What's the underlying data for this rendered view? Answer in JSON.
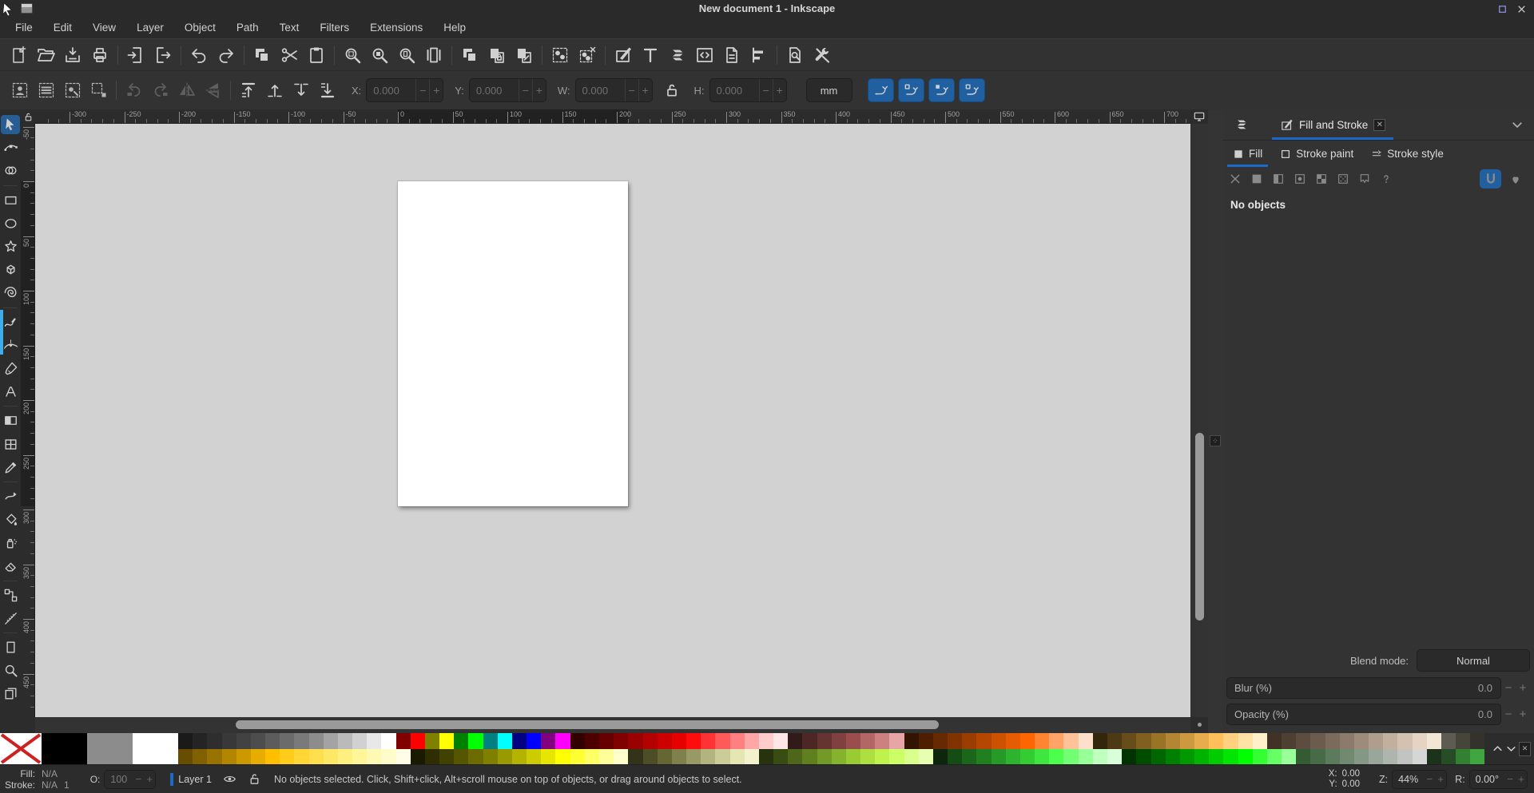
{
  "window": {
    "title": "New document 1 - Inkscape"
  },
  "menu": {
    "items": [
      "File",
      "Edit",
      "View",
      "Layer",
      "Object",
      "Path",
      "Text",
      "Filters",
      "Extensions",
      "Help"
    ]
  },
  "command_toolbar": {
    "groups": [
      [
        "new-document",
        "open-document",
        "save-document",
        "print"
      ],
      [
        "import",
        "export"
      ],
      [
        "undo",
        "redo"
      ],
      [
        "copy",
        "cut",
        "paste"
      ],
      [
        "zoom-selection",
        "zoom-drawing",
        "zoom-page",
        "zoom-1-1"
      ],
      [
        "duplicate",
        "create-clone",
        "unlink-clone"
      ],
      [
        "group",
        "ungroup"
      ],
      [
        "fill-stroke-dialog",
        "text-dialog",
        "layers-dialog",
        "xml-editor",
        "document-properties",
        "align-distribute"
      ],
      [
        "document-find",
        "preferences"
      ]
    ]
  },
  "tool_options": {
    "select_buttons": [
      "select-all",
      "select-all-layers",
      "select-same",
      "deselect"
    ],
    "transform_buttons": [
      "rotate-ccw",
      "rotate-cw",
      "flip-horizontal",
      "flip-vertical"
    ],
    "order_buttons": [
      "raise-to-top",
      "raise",
      "lower",
      "lower-to-bottom"
    ],
    "fields": [
      {
        "label": "X:",
        "value": "0.000"
      },
      {
        "label": "Y:",
        "value": "0.000"
      },
      {
        "label": "W:",
        "value": "0.000"
      },
      {
        "label": "H:",
        "value": "0.000"
      }
    ],
    "minus": "−",
    "plus": "+",
    "unit": "mm",
    "toggles": [
      "scale-stroke",
      "scale-corners",
      "move-gradients",
      "move-patterns"
    ]
  },
  "toolbox": {
    "tools": [
      "selector",
      "node-editor",
      "shape-builder",
      "rectangle",
      "ellipse",
      "star",
      "box-3d",
      "spiral",
      "pencil",
      "pen",
      "calligraphy",
      "text",
      "gradient",
      "mesh",
      "dropper",
      "tweak",
      "paint-bucket",
      "spray",
      "eraser",
      "connector",
      "measure",
      "page",
      "zoom",
      "pages"
    ],
    "active_tool": "selector",
    "separators_after": [
      2,
      7,
      11,
      14,
      18,
      20
    ]
  },
  "rulers": {
    "h_labels": [
      -300,
      -250,
      -200,
      -150,
      -100,
      -50,
      0,
      50,
      100,
      150,
      200,
      250,
      300,
      350,
      400,
      450,
      500,
      550,
      600,
      650,
      700
    ],
    "v_labels": [
      -50,
      0,
      50,
      100,
      150,
      200,
      250,
      300,
      350,
      400,
      450
    ]
  },
  "right_panel": {
    "dock_tab_label": "Fill and Stroke",
    "tabs": [
      {
        "label": "Fill",
        "icon": "fill-tab",
        "active": true
      },
      {
        "label": "Stroke paint",
        "icon": "stroke-paint-tab",
        "active": false
      },
      {
        "label": "Stroke style",
        "icon": "stroke-style-tab",
        "active": false
      }
    ],
    "paint_buttons": [
      "paint-none",
      "paint-flat",
      "paint-linear",
      "paint-radial",
      "paint-pattern",
      "paint-mesh",
      "paint-swatch",
      "paint-unknown"
    ],
    "fill_rule_buttons": [
      {
        "icon": "fillrule-nonzero",
        "active": true
      },
      {
        "icon": "fillrule-evenodd",
        "active": false
      }
    ],
    "no_objects": "No objects",
    "blend_label": "Blend mode:",
    "blend_value": "Normal",
    "blur_label": "Blur (%)",
    "blur_value": "0.0",
    "opacity_label": "Opacity (%)",
    "opacity_value": "0.0"
  },
  "status_bar": {
    "fill_label": "Fill:",
    "fill_value": "N/A",
    "stroke_label": "Stroke:",
    "stroke_value": "N/A",
    "stroke_width": "1",
    "opacity_label": "O:",
    "opacity_value": "100",
    "layer_label": "Layer 1",
    "message": "No objects selected. Click, Shift+click, Alt+scroll mouse on top of objects, or drag around objects to select.",
    "x_label": "X:",
    "x_value": "0.00",
    "y_label": "Y:",
    "y_value": "0.00",
    "zoom_label": "Z:",
    "zoom_value": "44%",
    "rotation_label": "R:",
    "rotation_value": "0.00°"
  },
  "colors": {
    "accent_blue": "#1b6acb",
    "toggle_blue": "#2160a0",
    "active_tool_blue": "#275d93",
    "highlight_stripe": "#3daee9",
    "canvas_desk": "#d2d2d2",
    "page": "#ffffff"
  },
  "palette": {
    "special": [
      {
        "name": "none",
        "color": "x"
      },
      {
        "name": "black",
        "color": "#000000"
      },
      {
        "name": "gray",
        "color": "#8c8c8c"
      },
      {
        "name": "white",
        "color": "#ffffff"
      }
    ],
    "row1": [
      "1a1a1a",
      "242424",
      "2e2e2e",
      "383838",
      "424242",
      "4d4d4d",
      "5c5c5c",
      "6b6b6b",
      "7a7a7a",
      "8c8c8c",
      "a3a3a3",
      "bababa",
      "d1d1d1",
      "e8e8e8",
      "ffffff",
      "800000",
      "ff0000",
      "808000",
      "ffff00",
      "008000",
      "00ff00",
      "008080",
      "00ffff",
      "000080",
      "0000ff",
      "800080",
      "ff00ff",
      "330000",
      "4d0000",
      "660000",
      "800000",
      "990000",
      "b30000",
      "cc0000",
      "e60000",
      "ff0d0d",
      "ff3333",
      "ff5959",
      "ff8080",
      "ffa6a6",
      "ffcccc",
      "ffe6e6",
      "331a1a",
      "4d2626",
      "663333",
      "804040",
      "994d4d",
      "b36666",
      "cc8080",
      "e6a6a6",
      "331400",
      "4d1f00",
      "662900",
      "803300",
      "993d00",
      "b34700",
      "cc5200",
      "e65c00",
      "ff6600",
      "ff8533",
      "ffa366",
      "ffc299",
      "ffe0cc",
      "33260d",
      "4d3913",
      "664d1a",
      "806020",
      "997326",
      "b38633",
      "cc9940",
      "e6ac4d",
      "ffbf59",
      "ffd180",
      "ffe3a6",
      "fff0cc",
      "403326",
      "4d4033",
      "5c4d40",
      "6b5c4d",
      "7a6b5c",
      "8c7a6b",
      "9e8c7a",
      "b09e8c",
      "c2b09e",
      "d4c2b0",
      "e6d4c2",
      "f2e6d4",
      "5c5c52",
      "454539",
      "33332b"
    ],
    "row2": [
      "664d00",
      "806000",
      "997300",
      "b38600",
      "cc9900",
      "e6ac00",
      "ffbf00",
      "ffcc1a",
      "ffd633",
      "ffdf4d",
      "ffe866",
      "fff080",
      "fff599",
      "fffab3",
      "fffccc",
      "fffde6",
      "1a1a00",
      "2e2e00",
      "424200",
      "565600",
      "6b6b00",
      "808000",
      "999900",
      "b3b300",
      "cccc00",
      "e6e600",
      "ffff00",
      "ffff33",
      "ffff66",
      "ffff99",
      "ffffcc",
      "33331a",
      "4d4d26",
      "666633",
      "80804d",
      "999966",
      "b3b380",
      "cccc99",
      "e6e6b3",
      "f2f2cc",
      "26330d",
      "394d13",
      "4d661a",
      "608020",
      "739926",
      "86b32d",
      "99cc33",
      "addf40",
      "c0f24d",
      "ccff66",
      "d9ff8c",
      "e6ffb3",
      "0d260d",
      "134d13",
      "1a661a",
      "208020",
      "269926",
      "2db32d",
      "33cc33",
      "40e640",
      "4dff4d",
      "73ff73",
      "99ff99",
      "bfffbf",
      "d9ffd9",
      "003300",
      "004d00",
      "006600",
      "008000",
      "009900",
      "00b300",
      "00cc00",
      "00e600",
      "00ff00",
      "33ff33",
      "66ff66",
      "99ff99",
      "335c33",
      "476b47",
      "5c7a5c",
      "708970",
      "859885",
      "99a699",
      "adb5ad",
      "c2c4c2",
      "d6d6d6",
      "1a331a",
      "264d26",
      "338033",
      "40a640"
    ]
  }
}
